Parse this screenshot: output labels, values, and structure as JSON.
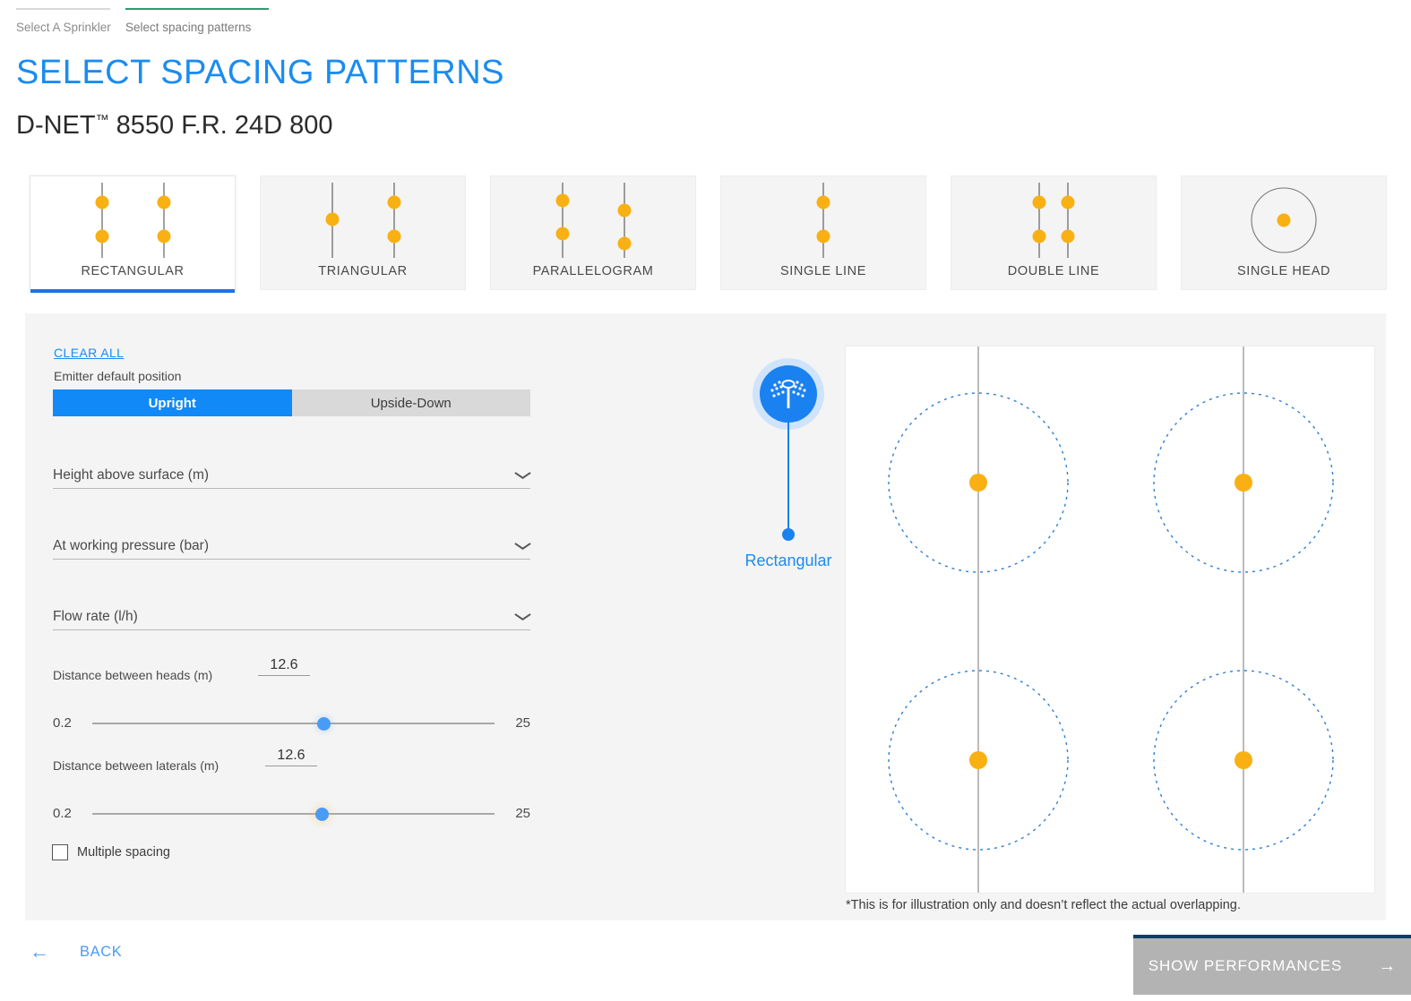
{
  "steps": [
    {
      "label": "Select A Sprinkler",
      "state": "done",
      "bar_color": "#d8d8d8"
    },
    {
      "label": "Select spacing patterns",
      "state": "active",
      "bar_color": "#22a06b"
    }
  ],
  "header": {
    "title": "SELECT SPACING PATTERNS",
    "product_prefix": "D-NET",
    "product_tm": "™",
    "product_suffix": " 8550 F.R. 24D 800",
    "title_color": "#1a8cf0"
  },
  "patterns": [
    {
      "label": "RECTANGULAR",
      "icon": "rectangular-pattern-icon",
      "selected": true
    },
    {
      "label": "TRIANGULAR",
      "icon": "triangular-pattern-icon",
      "selected": false
    },
    {
      "label": "PARALLELOGRAM",
      "icon": "parallelogram-pattern-icon",
      "selected": false
    },
    {
      "label": "SINGLE LINE",
      "icon": "single-line-pattern-icon",
      "selected": false
    },
    {
      "label": "DOUBLE LINE",
      "icon": "double-line-pattern-icon",
      "selected": false
    },
    {
      "label": "SINGLE HEAD",
      "icon": "single-head-pattern-icon",
      "selected": false
    }
  ],
  "controls": {
    "clear_all": "CLEAR ALL",
    "emitter_label": "Emitter default position",
    "emitter_options": [
      {
        "label": "Upright",
        "selected": true
      },
      {
        "label": "Upside-Down",
        "selected": false
      }
    ],
    "dropdowns": [
      {
        "label": "Height above surface (m)",
        "value": "",
        "icon": "chevron-down-icon"
      },
      {
        "label": "At working pressure (bar)",
        "value": "",
        "icon": "chevron-down-icon"
      },
      {
        "label": "Flow rate (l/h)",
        "value": "",
        "icon": "chevron-down-icon"
      }
    ],
    "heads": {
      "label": "Distance between heads (m)",
      "value": "12.6",
      "min": "0.2",
      "max": "25",
      "thumb_percent": 57
    },
    "laterals": {
      "label": "Distance between laterals (m)",
      "value": "12.6",
      "min": "0.2",
      "max": "25",
      "thumb_percent": 57
    },
    "multiple_spacing": {
      "label": "Multiple spacing",
      "checked": false
    }
  },
  "preview": {
    "badge_icon": "sprinkler-head-icon",
    "badge_label": "Rectangular",
    "note": "*This is for illustration only and doesn’t reflect the actual overlapping.",
    "head_color": "#f9b013",
    "wetted_circle_color": "#2d7fd3",
    "lateral_line_color": "#666666"
  },
  "footer": {
    "back_label": "BACK",
    "back_icon": "arrow-left-icon",
    "show_label": "SHOW PERFORMANCES",
    "show_icon": "arrow-right-icon",
    "show_enabled": false
  }
}
